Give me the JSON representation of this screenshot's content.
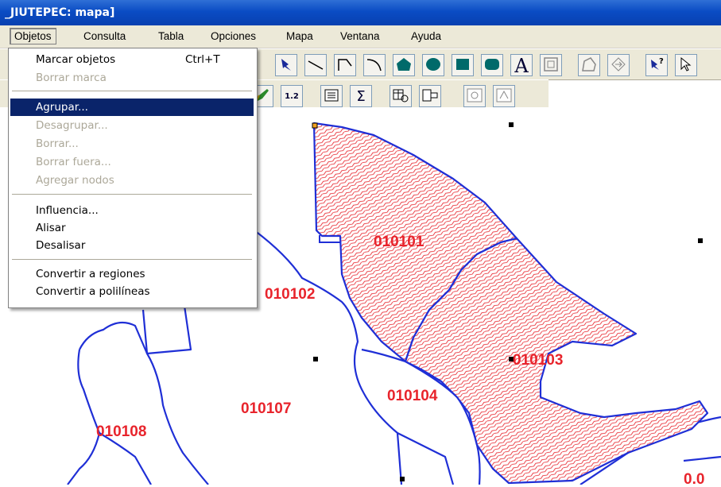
{
  "window": {
    "title": "_JIUTEPEC: mapa]"
  },
  "menubar": {
    "items": [
      "Objetos",
      "Consulta",
      "Tabla",
      "Opciones",
      "Mapa",
      "Ventana",
      "Ayuda"
    ]
  },
  "toolbar": {
    "text_tool": "A",
    "sum_tool": "Σ",
    "ruler_tool": "1.2"
  },
  "objetos_menu": {
    "items": [
      {
        "label": "Marcar objetos",
        "shortcut": "Ctrl+T",
        "enabled": true
      },
      {
        "label": "Borrar marca",
        "enabled": false
      },
      {
        "label": "Agrupar...",
        "enabled": true,
        "highlighted": true
      },
      {
        "label": "Desagrupar...",
        "enabled": false
      },
      {
        "label": "Borrar...",
        "enabled": false
      },
      {
        "label": "Borrar fuera...",
        "enabled": false
      },
      {
        "label": "Agregar nodos",
        "enabled": false
      },
      {
        "label": "Influencia...",
        "enabled": true
      },
      {
        "label": "Alisar",
        "enabled": true
      },
      {
        "label": "Desalisar",
        "enabled": true
      },
      {
        "label": "Convertir a regiones",
        "enabled": true
      },
      {
        "label": "Convertir a polilíneas",
        "enabled": true
      }
    ]
  },
  "map": {
    "regions": [
      "010101",
      "010102",
      "010103",
      "010104",
      "010107",
      "010108"
    ],
    "partial_label": "0.0",
    "boundary_color": "#1f2fd6",
    "label_color": "#e8242c",
    "selection_hatch_color": "#e8242c"
  }
}
